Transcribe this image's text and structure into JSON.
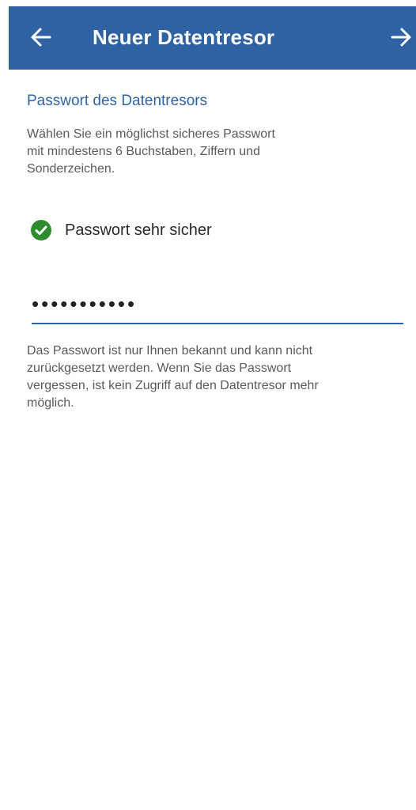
{
  "header": {
    "title": "Neuer Datentresor",
    "back_icon": "arrow-left-icon",
    "next_icon": "arrow-right-icon",
    "background": "#2f62a3"
  },
  "section": {
    "title": "Passwort des Datentresors",
    "hint": "Wählen Sie ein möglichst sicheres Passwort\nmit mindestens 6 Buchstaben, Ziffern und\nSonderzeichen."
  },
  "strength": {
    "icon": "check-circle-icon",
    "color": "#2e8b2e",
    "label": "Passwort sehr sicher"
  },
  "password": {
    "value": "•••••••••••"
  },
  "note": {
    "text": "Das Passwort ist nur Ihnen bekannt und kann nicht\nzurückgesetzt werden. Wenn Sie das Passwort\nvergessen, ist kein Zugriff auf den Datentresor mehr\nmöglich."
  }
}
